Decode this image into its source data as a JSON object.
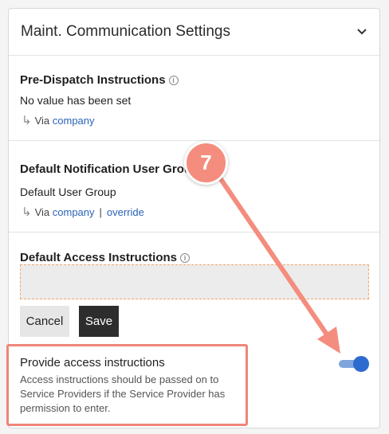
{
  "panel": {
    "title": "Maint. Communication Settings"
  },
  "pre_dispatch": {
    "label": "Pre-Dispatch Instructions",
    "value": "No value has been set",
    "via_label": "Via",
    "via_link": "company"
  },
  "default_notification": {
    "label": "Default Notification User Group",
    "value": "Default User Group",
    "via_label": "Via",
    "via_link": "company",
    "separator": "|",
    "override_link": "override"
  },
  "default_access": {
    "label": "Default Access Instructions",
    "input_value": ""
  },
  "buttons": {
    "cancel": "Cancel",
    "save": "Save"
  },
  "provide_access": {
    "title": "Provide access instructions",
    "description": "Access instructions should be passed on to Service Providers if the Service Provider has permission to enter.",
    "enabled": true
  },
  "annotation": {
    "step_number": "7",
    "color": "#f48d7e"
  },
  "icons": {
    "collapse": "chevron-down-icon",
    "info": "info-icon",
    "via": "return-arrow-icon"
  },
  "colors": {
    "link": "#2a63b8",
    "toggle_on": "#2e6bcf",
    "save_bg": "#2d2d2d"
  }
}
